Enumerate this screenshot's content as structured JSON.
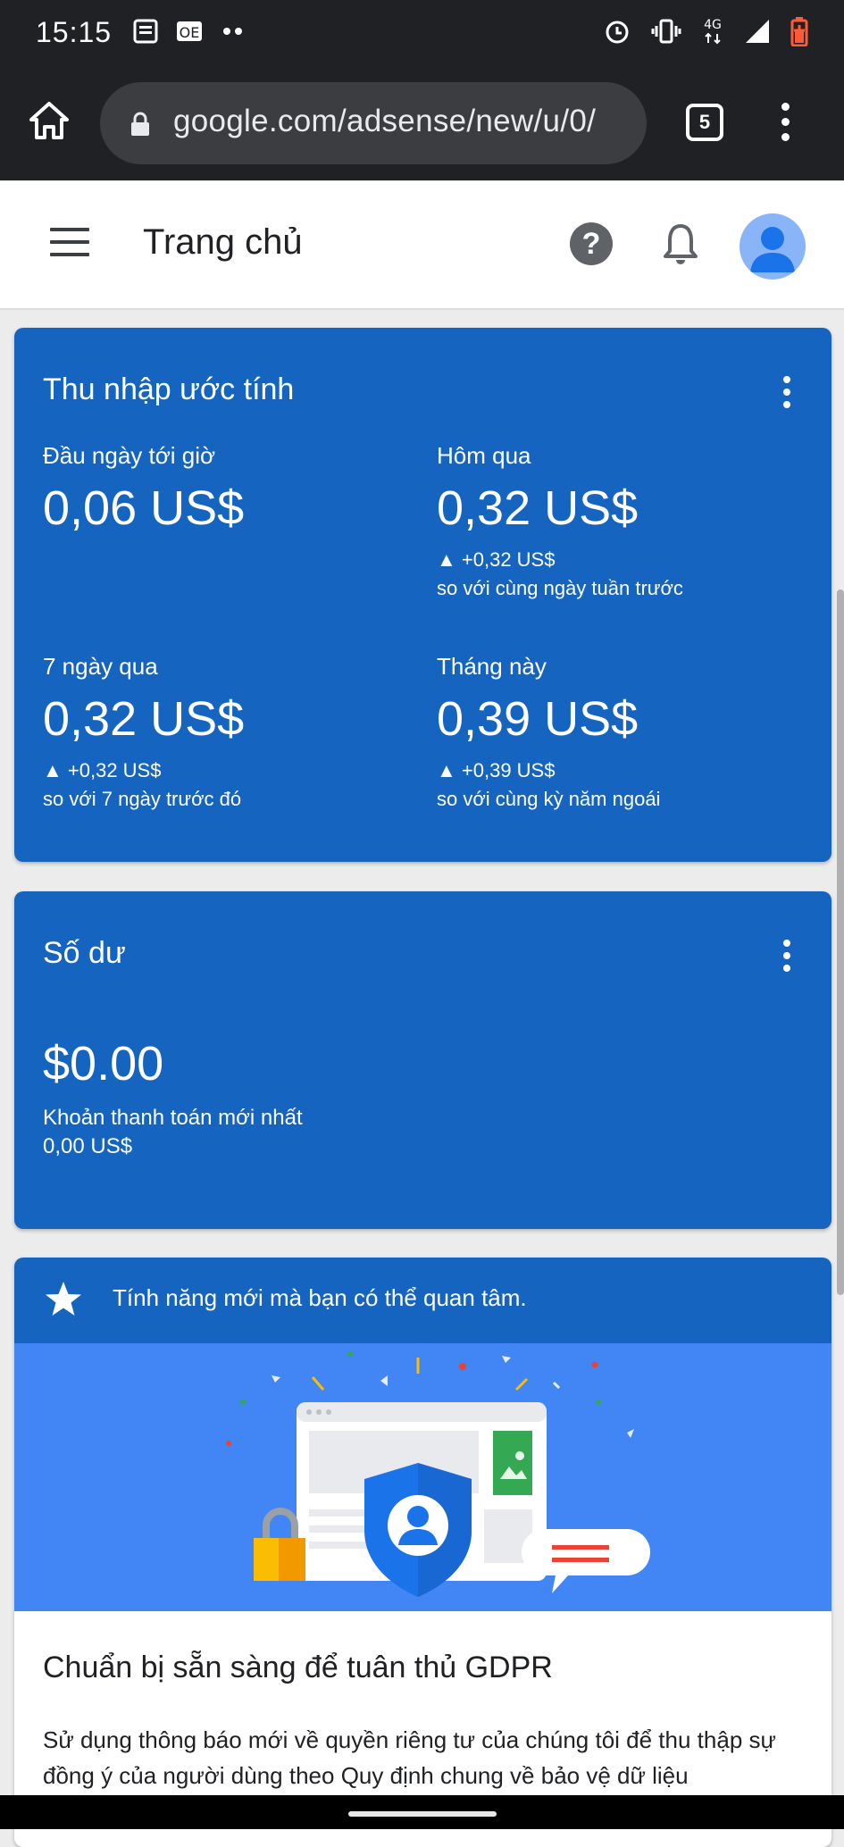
{
  "status_bar": {
    "time": "15:15",
    "network": "4G"
  },
  "browser": {
    "url": "google.com/adsense/new/u/0/",
    "tab_count": "5"
  },
  "app_bar": {
    "title": "Trang chủ"
  },
  "earnings_card": {
    "title": "Thu nhập ước tính",
    "metrics": [
      {
        "label": "Đầu ngày tới giờ",
        "value": "0,06 US$",
        "delta": "",
        "compare": ""
      },
      {
        "label": "Hôm qua",
        "value": "0,32 US$",
        "delta": "▲ +0,32 US$",
        "compare": "so với cùng ngày tuần trước"
      },
      {
        "label": "7 ngày qua",
        "value": "0,32 US$",
        "delta": "▲ +0,32 US$",
        "compare": "so với 7 ngày trước đó"
      },
      {
        "label": "Tháng này",
        "value": "0,39 US$",
        "delta": "▲ +0,39 US$",
        "compare": "so với cùng kỳ năm ngoái"
      }
    ]
  },
  "balance_card": {
    "title": "Số dư",
    "value": "$0.00",
    "last_payment_label": "Khoản thanh toán mới nhất",
    "last_payment_value": "0,00 US$"
  },
  "feature_card": {
    "header": "Tính năng mới mà bạn có thể quan tâm.",
    "title": "Chuẩn bị sẵn sàng để tuân thủ GDPR",
    "body": "Sử dụng thông báo mới về quyền riêng tư của chúng tôi để thu thập sự đồng ý của người dùng theo Quy định chung về bảo vệ dữ liệu"
  },
  "colors": {
    "card_blue": "#1565c0",
    "illustration_blue": "#4285f4",
    "chrome_dark": "#202124"
  }
}
